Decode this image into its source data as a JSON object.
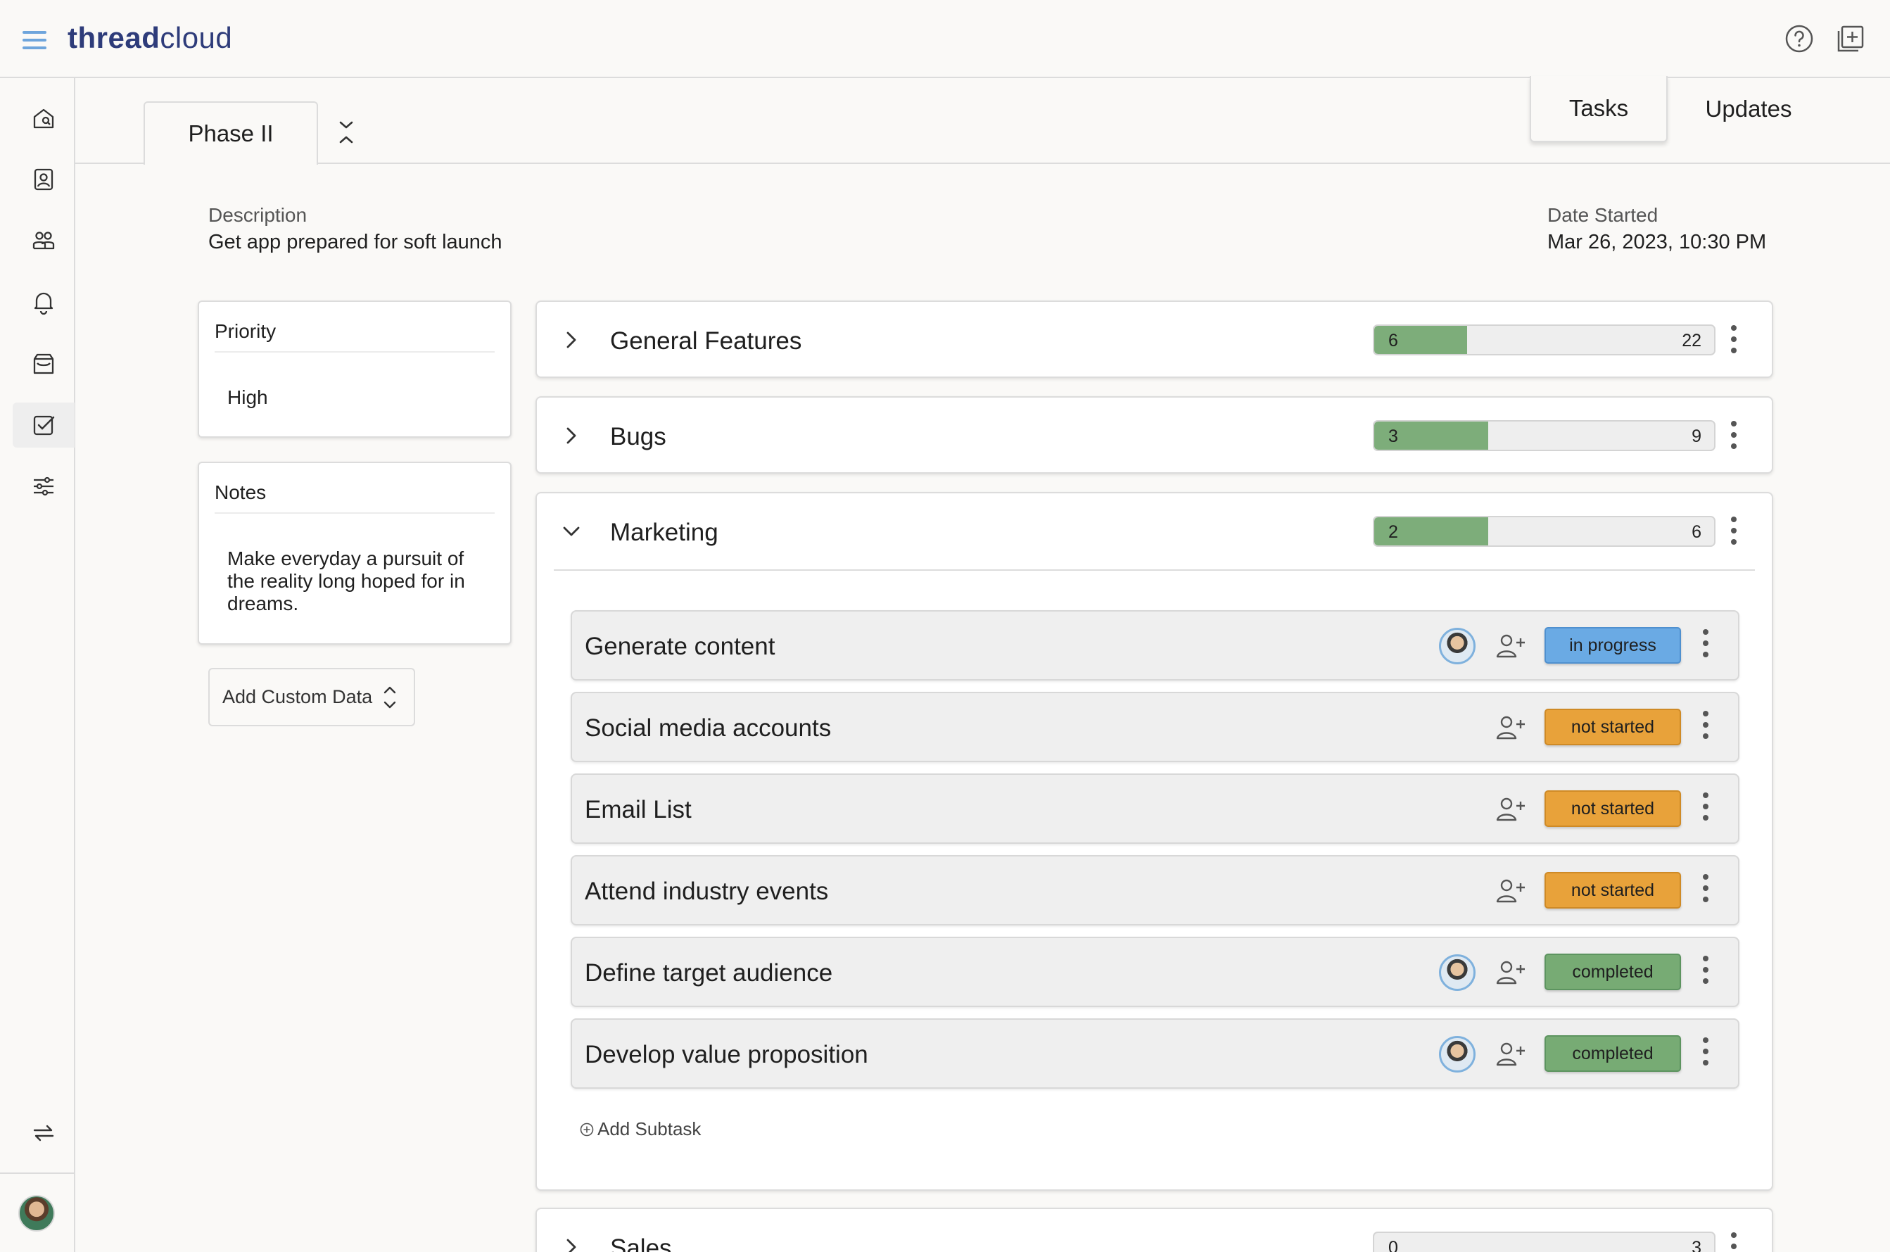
{
  "header": {
    "logo_bold": "thread",
    "logo_light": "cloud",
    "icons": [
      "menu-icon",
      "help-icon",
      "add-window-icon"
    ]
  },
  "sidebar": {
    "items": [
      {
        "name": "home-icon"
      },
      {
        "name": "contacts-icon"
      },
      {
        "name": "team-icon"
      },
      {
        "name": "notifications-icon"
      },
      {
        "name": "inbox-icon"
      },
      {
        "name": "tasks-icon",
        "active": true
      },
      {
        "name": "settings-sliders-icon"
      }
    ],
    "bottom": [
      "sync-icon",
      "user-avatar"
    ]
  },
  "phase_tab": {
    "label": "Phase II"
  },
  "view_tabs": {
    "tasks": "Tasks",
    "updates": "Updates"
  },
  "description": {
    "label": "Description",
    "value": "Get app prepared for soft launch"
  },
  "date_started": {
    "label": "Date Started",
    "value": "Mar 26, 2023, 10:30 PM"
  },
  "priority": {
    "label": "Priority",
    "value": "High"
  },
  "notes": {
    "label": "Notes",
    "value": "Make everyday a pursuit of the reality long hoped for in dreams."
  },
  "add_custom_data": {
    "label": "Add Custom Data"
  },
  "groups": [
    {
      "name": "General Features",
      "done": "6",
      "total": "22",
      "expanded": false
    },
    {
      "name": "Bugs",
      "done": "3",
      "total": "9",
      "expanded": false
    },
    {
      "name": "Marketing",
      "done": "2",
      "total": "6",
      "expanded": true
    },
    {
      "name": "Sales",
      "done": "0",
      "total": "3",
      "expanded": false
    }
  ],
  "subtasks": [
    {
      "name": "Generate content",
      "assigned": true,
      "status": "in progress",
      "color": "#6aaae4"
    },
    {
      "name": "Social media accounts",
      "assigned": false,
      "status": "not started",
      "color": "#e8a23a"
    },
    {
      "name": "Email List",
      "assigned": false,
      "status": "not started",
      "color": "#e8a23a"
    },
    {
      "name": "Attend industry events",
      "assigned": false,
      "status": "not started",
      "color": "#e8a23a"
    },
    {
      "name": "Define target audience",
      "assigned": true,
      "status": "completed",
      "color": "#77ab74"
    },
    {
      "name": "Develop value proposition",
      "assigned": true,
      "status": "completed",
      "color": "#77ab74"
    }
  ],
  "add_subtask": {
    "label": "Add Subtask"
  }
}
